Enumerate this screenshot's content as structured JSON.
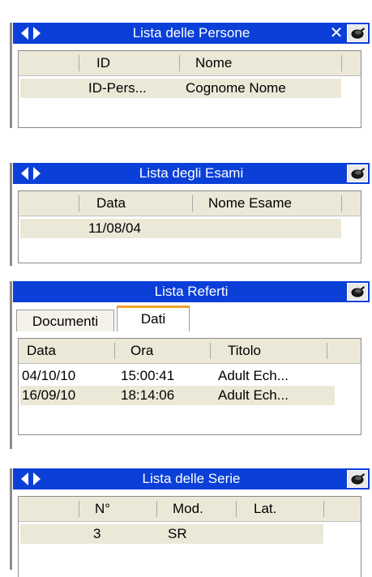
{
  "panels": {
    "persone": {
      "title": "Lista delle Persone",
      "close": "✕",
      "columns": [
        "ID",
        "Nome"
      ],
      "rows": [
        {
          "id": "ID-Pers...",
          "nome": "Cognome Nome"
        }
      ]
    },
    "esami": {
      "title": "Lista degli Esami",
      "columns": [
        "Data",
        "Nome Esame"
      ],
      "rows": [
        {
          "data": "11/08/04",
          "nome": ""
        }
      ]
    },
    "referti": {
      "title": "Lista Referti",
      "tabs": [
        "Documenti",
        "Dati"
      ],
      "active_tab": "Dati",
      "columns": [
        "Data",
        "Ora",
        "Titolo"
      ],
      "rows": [
        {
          "data": "04/10/10",
          "ora": "15:00:41",
          "titolo": "Adult Ech..."
        },
        {
          "data": "16/09/10",
          "ora": "18:14:06",
          "titolo": "Adult Ech..."
        }
      ]
    },
    "serie": {
      "title": "Lista delle Serie",
      "columns": [
        "N°",
        "Mod.",
        "Lat."
      ],
      "rows": [
        {
          "n": "3",
          "mod": "SR",
          "lat": ""
        }
      ]
    }
  },
  "colors": {
    "titlebar": "#0a3fd8",
    "header_bg": "#ece8d8",
    "active_tab_accent": "#f0a22a"
  },
  "icons": [
    "back-arrow-icon",
    "forward-arrow-icon",
    "close-icon",
    "pin-icon"
  ]
}
